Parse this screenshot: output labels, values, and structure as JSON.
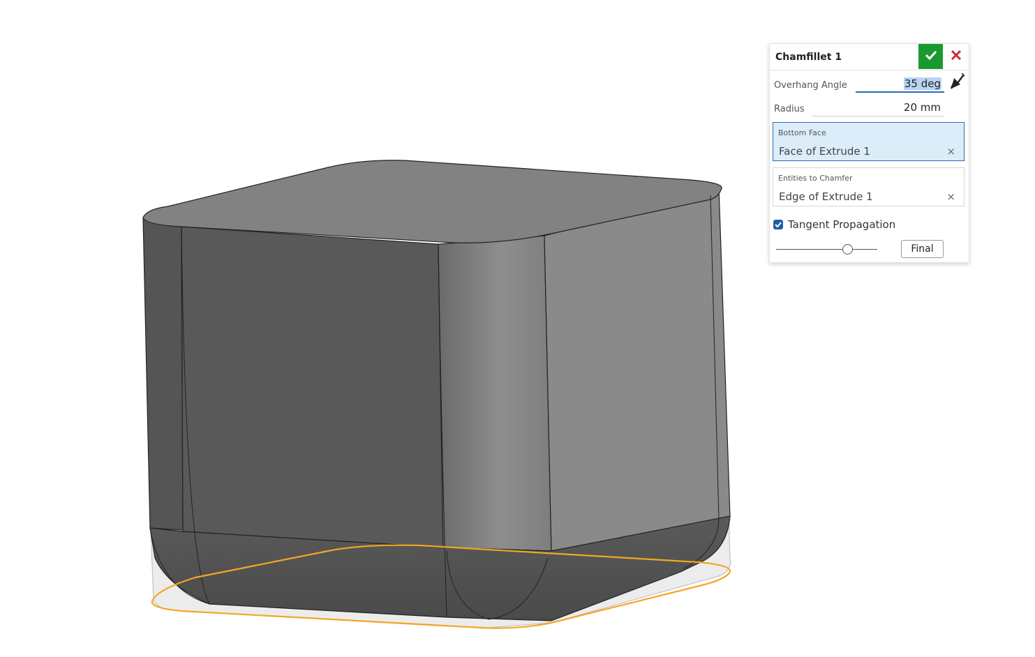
{
  "panel": {
    "title": "Chamfillet 1",
    "confirm_icon": "checkmark-icon",
    "cancel_icon": "close-icon",
    "overhang_angle": {
      "label": "Overhang Angle",
      "value": "35 deg"
    },
    "flip_icon": "flip-direction-icon",
    "radius": {
      "label": "Radius",
      "value": "20 mm"
    },
    "bottom_face": {
      "caption": "Bottom Face",
      "item": "Face of Extrude 1",
      "remove": "×"
    },
    "entities": {
      "caption": "Entities to Chamfer",
      "item": "Edge of Extrude 1",
      "remove": "×"
    },
    "tangent_propagation": {
      "label": "Tangent Propagation",
      "checked": true
    },
    "slider": {
      "level": 0.7
    },
    "final_label": "Final"
  },
  "colors": {
    "confirm_green": "#1a9a2e",
    "cancel_red": "#cc2a36",
    "selection_blue": "#2b6cb0",
    "highlight_orange": "#f5a623",
    "part_gray": "#5c5c5c"
  }
}
